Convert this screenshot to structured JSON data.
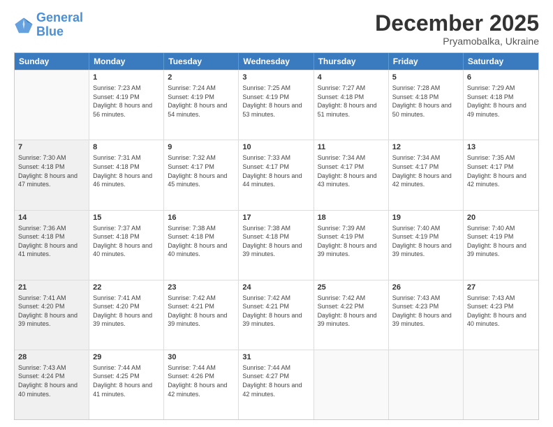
{
  "logo": {
    "line1": "General",
    "line2": "Blue"
  },
  "title": {
    "month_year": "December 2025",
    "location": "Pryamobalka, Ukraine"
  },
  "headers": [
    "Sunday",
    "Monday",
    "Tuesday",
    "Wednesday",
    "Thursday",
    "Friday",
    "Saturday"
  ],
  "rows": [
    [
      {
        "day": "",
        "sunrise": "",
        "sunset": "",
        "daylight": "",
        "empty": true
      },
      {
        "day": "1",
        "sunrise": "Sunrise: 7:23 AM",
        "sunset": "Sunset: 4:19 PM",
        "daylight": "Daylight: 8 hours and 56 minutes."
      },
      {
        "day": "2",
        "sunrise": "Sunrise: 7:24 AM",
        "sunset": "Sunset: 4:19 PM",
        "daylight": "Daylight: 8 hours and 54 minutes."
      },
      {
        "day": "3",
        "sunrise": "Sunrise: 7:25 AM",
        "sunset": "Sunset: 4:19 PM",
        "daylight": "Daylight: 8 hours and 53 minutes."
      },
      {
        "day": "4",
        "sunrise": "Sunrise: 7:27 AM",
        "sunset": "Sunset: 4:18 PM",
        "daylight": "Daylight: 8 hours and 51 minutes."
      },
      {
        "day": "5",
        "sunrise": "Sunrise: 7:28 AM",
        "sunset": "Sunset: 4:18 PM",
        "daylight": "Daylight: 8 hours and 50 minutes."
      },
      {
        "day": "6",
        "sunrise": "Sunrise: 7:29 AM",
        "sunset": "Sunset: 4:18 PM",
        "daylight": "Daylight: 8 hours and 49 minutes."
      }
    ],
    [
      {
        "day": "7",
        "sunrise": "Sunrise: 7:30 AM",
        "sunset": "Sunset: 4:18 PM",
        "daylight": "Daylight: 8 hours and 47 minutes.",
        "shaded": true
      },
      {
        "day": "8",
        "sunrise": "Sunrise: 7:31 AM",
        "sunset": "Sunset: 4:18 PM",
        "daylight": "Daylight: 8 hours and 46 minutes."
      },
      {
        "day": "9",
        "sunrise": "Sunrise: 7:32 AM",
        "sunset": "Sunset: 4:17 PM",
        "daylight": "Daylight: 8 hours and 45 minutes."
      },
      {
        "day": "10",
        "sunrise": "Sunrise: 7:33 AM",
        "sunset": "Sunset: 4:17 PM",
        "daylight": "Daylight: 8 hours and 44 minutes."
      },
      {
        "day": "11",
        "sunrise": "Sunrise: 7:34 AM",
        "sunset": "Sunset: 4:17 PM",
        "daylight": "Daylight: 8 hours and 43 minutes."
      },
      {
        "day": "12",
        "sunrise": "Sunrise: 7:34 AM",
        "sunset": "Sunset: 4:17 PM",
        "daylight": "Daylight: 8 hours and 42 minutes."
      },
      {
        "day": "13",
        "sunrise": "Sunrise: 7:35 AM",
        "sunset": "Sunset: 4:17 PM",
        "daylight": "Daylight: 8 hours and 42 minutes."
      }
    ],
    [
      {
        "day": "14",
        "sunrise": "Sunrise: 7:36 AM",
        "sunset": "Sunset: 4:18 PM",
        "daylight": "Daylight: 8 hours and 41 minutes.",
        "shaded": true
      },
      {
        "day": "15",
        "sunrise": "Sunrise: 7:37 AM",
        "sunset": "Sunset: 4:18 PM",
        "daylight": "Daylight: 8 hours and 40 minutes."
      },
      {
        "day": "16",
        "sunrise": "Sunrise: 7:38 AM",
        "sunset": "Sunset: 4:18 PM",
        "daylight": "Daylight: 8 hours and 40 minutes."
      },
      {
        "day": "17",
        "sunrise": "Sunrise: 7:38 AM",
        "sunset": "Sunset: 4:18 PM",
        "daylight": "Daylight: 8 hours and 39 minutes."
      },
      {
        "day": "18",
        "sunrise": "Sunrise: 7:39 AM",
        "sunset": "Sunset: 4:19 PM",
        "daylight": "Daylight: 8 hours and 39 minutes."
      },
      {
        "day": "19",
        "sunrise": "Sunrise: 7:40 AM",
        "sunset": "Sunset: 4:19 PM",
        "daylight": "Daylight: 8 hours and 39 minutes."
      },
      {
        "day": "20",
        "sunrise": "Sunrise: 7:40 AM",
        "sunset": "Sunset: 4:19 PM",
        "daylight": "Daylight: 8 hours and 39 minutes."
      }
    ],
    [
      {
        "day": "21",
        "sunrise": "Sunrise: 7:41 AM",
        "sunset": "Sunset: 4:20 PM",
        "daylight": "Daylight: 8 hours and 39 minutes.",
        "shaded": true
      },
      {
        "day": "22",
        "sunrise": "Sunrise: 7:41 AM",
        "sunset": "Sunset: 4:20 PM",
        "daylight": "Daylight: 8 hours and 39 minutes."
      },
      {
        "day": "23",
        "sunrise": "Sunrise: 7:42 AM",
        "sunset": "Sunset: 4:21 PM",
        "daylight": "Daylight: 8 hours and 39 minutes."
      },
      {
        "day": "24",
        "sunrise": "Sunrise: 7:42 AM",
        "sunset": "Sunset: 4:21 PM",
        "daylight": "Daylight: 8 hours and 39 minutes."
      },
      {
        "day": "25",
        "sunrise": "Sunrise: 7:42 AM",
        "sunset": "Sunset: 4:22 PM",
        "daylight": "Daylight: 8 hours and 39 minutes."
      },
      {
        "day": "26",
        "sunrise": "Sunrise: 7:43 AM",
        "sunset": "Sunset: 4:23 PM",
        "daylight": "Daylight: 8 hours and 39 minutes."
      },
      {
        "day": "27",
        "sunrise": "Sunrise: 7:43 AM",
        "sunset": "Sunset: 4:23 PM",
        "daylight": "Daylight: 8 hours and 40 minutes."
      }
    ],
    [
      {
        "day": "28",
        "sunrise": "Sunrise: 7:43 AM",
        "sunset": "Sunset: 4:24 PM",
        "daylight": "Daylight: 8 hours and 40 minutes.",
        "shaded": true
      },
      {
        "day": "29",
        "sunrise": "Sunrise: 7:44 AM",
        "sunset": "Sunset: 4:25 PM",
        "daylight": "Daylight: 8 hours and 41 minutes."
      },
      {
        "day": "30",
        "sunrise": "Sunrise: 7:44 AM",
        "sunset": "Sunset: 4:26 PM",
        "daylight": "Daylight: 8 hours and 42 minutes."
      },
      {
        "day": "31",
        "sunrise": "Sunrise: 7:44 AM",
        "sunset": "Sunset: 4:27 PM",
        "daylight": "Daylight: 8 hours and 42 minutes."
      },
      {
        "day": "",
        "sunrise": "",
        "sunset": "",
        "daylight": "",
        "empty": true
      },
      {
        "day": "",
        "sunrise": "",
        "sunset": "",
        "daylight": "",
        "empty": true
      },
      {
        "day": "",
        "sunrise": "",
        "sunset": "",
        "daylight": "",
        "empty": true
      }
    ]
  ]
}
